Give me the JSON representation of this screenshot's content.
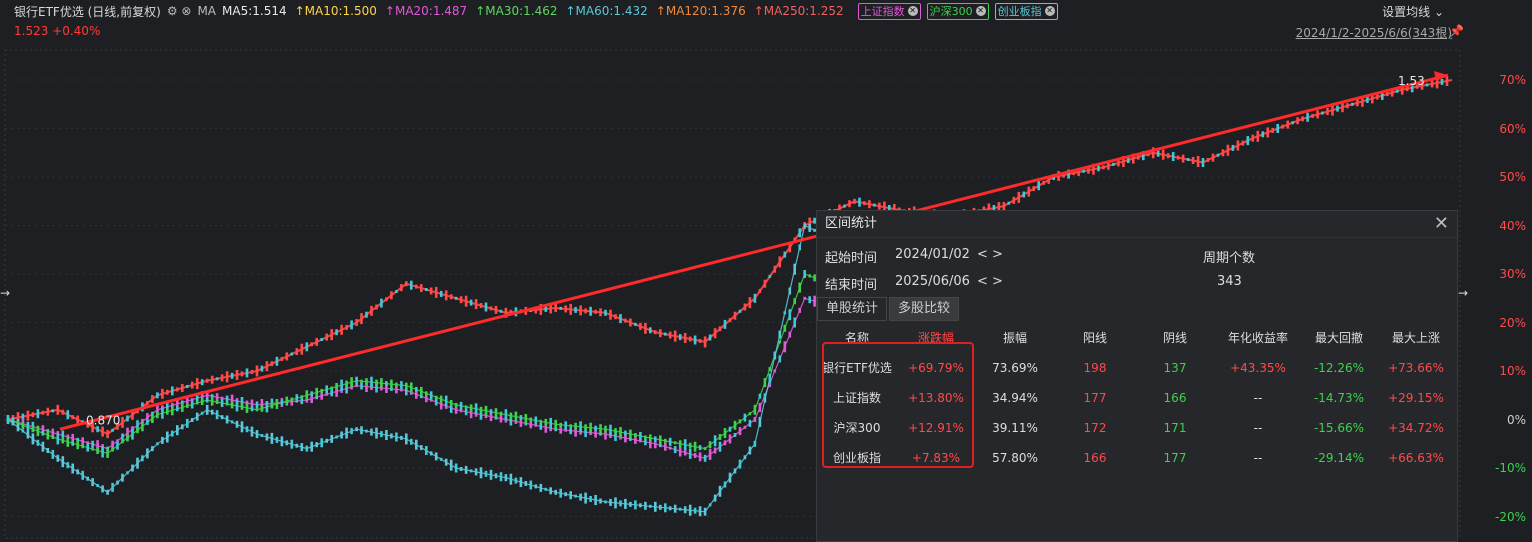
{
  "header": {
    "title": "银行ETF优选 (日线,前复权)",
    "ma_label": "MA",
    "ma_values": [
      {
        "label": "MA5:1.514",
        "color": "#e8e8e8"
      },
      {
        "label": "↑MA10:1.500",
        "color": "#ffd34a"
      },
      {
        "label": "↑MA20:1.487",
        "color": "#e05ad8"
      },
      {
        "label": "↑MA30:1.462",
        "color": "#5fd65f"
      },
      {
        "label": "↑MA60:1.432",
        "color": "#5bc7d9"
      },
      {
        "label": "↑MA120:1.376",
        "color": "#f08a3c"
      },
      {
        "label": "↑MA250:1.252",
        "color": "#f06060"
      }
    ],
    "tags": [
      {
        "label": "上证指数",
        "color": "#e05ad8"
      },
      {
        "label": "沪深300",
        "color": "#3ed14d"
      },
      {
        "label": "创业板指",
        "color": "#5bc7d9"
      }
    ],
    "setting_label": "设置均线",
    "price_line": "1.523  +0.40%",
    "range_info": "2024/1/2-2025/6/6(343根)"
  },
  "chart_data": {
    "type": "candlestick",
    "y_axis_labels": [
      "70%",
      "60%",
      "50%",
      "40%",
      "30%",
      "20%",
      "10%",
      "0%",
      "-10%",
      "-20%"
    ],
    "y_axis_values": [
      70,
      60,
      50,
      40,
      30,
      20,
      10,
      0,
      -10,
      -20
    ],
    "low_label": "0.870",
    "high_label": "1.53",
    "series": [
      {
        "name": "银行ETF优选",
        "color": "#ff4a4a",
        "values": [
          0,
          2,
          -3,
          5,
          8,
          10,
          15,
          20,
          28,
          25,
          22,
          23,
          22,
          18,
          16,
          25,
          40,
          45,
          43,
          42,
          44,
          50,
          52,
          55,
          53,
          58,
          62,
          65,
          68,
          70
        ]
      },
      {
        "name": "上证指数",
        "color": "#e05ad8",
        "values": [
          0,
          -3,
          -6,
          2,
          5,
          3,
          4,
          7,
          6,
          2,
          0,
          -2,
          -3,
          -5,
          -8,
          0,
          25,
          22,
          18,
          20,
          22,
          20,
          18,
          17,
          16,
          15,
          14,
          13,
          14,
          14
        ]
      },
      {
        "name": "沪深300",
        "color": "#3ed14d",
        "values": [
          0,
          -4,
          -7,
          1,
          4,
          2,
          5,
          8,
          7,
          3,
          1,
          -1,
          -2,
          -4,
          -6,
          2,
          30,
          26,
          20,
          22,
          23,
          20,
          17,
          15,
          14,
          13,
          13,
          12,
          13,
          13
        ]
      },
      {
        "name": "创业板指",
        "color": "#5bc7d9",
        "values": [
          0,
          -8,
          -15,
          -5,
          2,
          -3,
          -6,
          -2,
          -4,
          -10,
          -12,
          -15,
          -17,
          -18,
          -19,
          -5,
          40,
          35,
          28,
          27,
          26,
          22,
          18,
          15,
          12,
          10,
          9,
          8,
          8,
          8
        ]
      }
    ]
  },
  "panel": {
    "title": "区间统计",
    "start_label": "起始时间",
    "start_value": "2024/01/02",
    "end_label": "结束时间",
    "end_value": "2025/06/06",
    "nav_arrows": "< >",
    "period_label": "周期个数",
    "period_value": "343",
    "tab_single": "单股统计",
    "tab_multi": "多股比较",
    "headers": [
      "名称",
      "涨跌幅",
      "振幅",
      "阳线",
      "阴线",
      "年化收益率",
      "最大回撤",
      "最大上涨"
    ],
    "rows": [
      {
        "name": "银行ETF优选",
        "change": "+69.79%",
        "amp": "73.69%",
        "yang": "198",
        "yin": "137",
        "annual": "+43.35%",
        "dd": "-12.26%",
        "up": "+73.66%"
      },
      {
        "name": "上证指数",
        "change": "+13.80%",
        "amp": "34.94%",
        "yang": "177",
        "yin": "166",
        "annual": "--",
        "dd": "-14.73%",
        "up": "+29.15%"
      },
      {
        "name": "沪深300",
        "change": "+12.91%",
        "amp": "39.11%",
        "yang": "172",
        "yin": "171",
        "annual": "--",
        "dd": "-15.66%",
        "up": "+34.72%"
      },
      {
        "name": "创业板指",
        "change": "+7.83%",
        "amp": "57.80%",
        "yang": "166",
        "yin": "177",
        "annual": "--",
        "dd": "-29.14%",
        "up": "+66.63%"
      }
    ]
  }
}
